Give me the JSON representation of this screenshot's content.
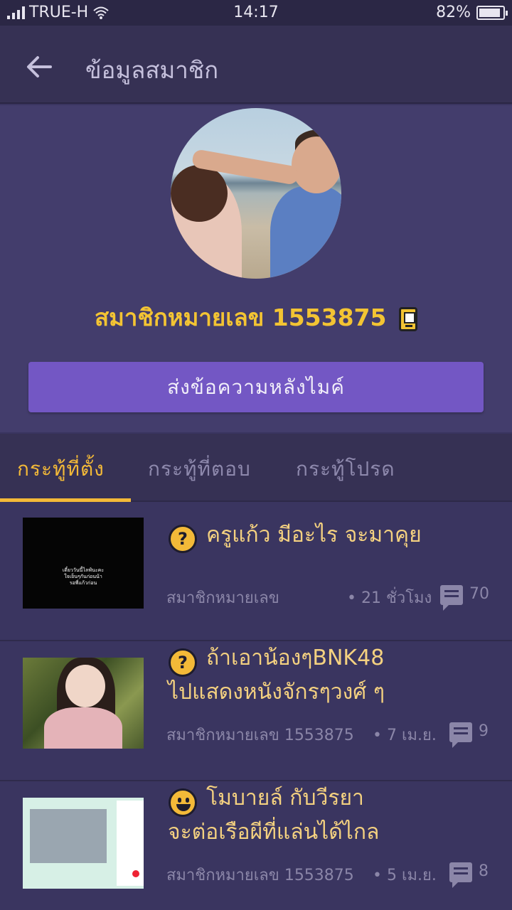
{
  "status_bar": {
    "carrier": "TRUE-H",
    "time": "14:17",
    "battery": "82%"
  },
  "header": {
    "title": "ข้อมูลสมาชิก"
  },
  "profile": {
    "member_label": "สมาชิกหมายเลข 1553875",
    "send_message_button": "ส่งข้อความหลังไมค์"
  },
  "tabs": [
    {
      "label": "กระทู้ที่ตั้ง",
      "active": true
    },
    {
      "label": "กระทู้ที่ตอบ",
      "active": false
    },
    {
      "label": "กระทู้โปรด",
      "active": false
    }
  ],
  "posts": [
    {
      "icon": "question-icon",
      "title_line1": "ครูแก้ว มีอะไร จะมาคุย",
      "title_line2": "",
      "thumb_text": "เดี๋ยววันนี้ไลฟ์นะคะ\nใจเย็นๆกันก่อนน้า\nรอพี่แก้วก่อน",
      "author": "สมาชิกหมายเลข",
      "time": "• 21 ชั่วโมง",
      "comments": "70"
    },
    {
      "icon": "question-icon",
      "title_line1": "ถ้าเอาน้องๆBNK48",
      "title_line2": "ไปแสดงหนังจักรๆวงศ์ ๆ",
      "author": "สมาชิกหมายเลข 1553875",
      "time": "• 7 เม.ย.",
      "comments": "9"
    },
    {
      "icon": "smile-icon",
      "title_line1": "โมบายล์ กับวีรยา",
      "title_line2": "จะต่อเรือผีที่แล่นได้ไกล",
      "author": "สมาชิกหมายเลข 1553875",
      "time": "• 5 เม.ย.",
      "comments": "8"
    }
  ],
  "colors": {
    "background": "#3a3560",
    "accent": "#f3b938",
    "button": "#7357c4",
    "title": "#f4d180"
  }
}
